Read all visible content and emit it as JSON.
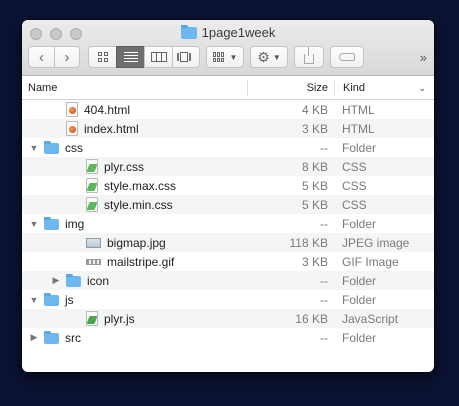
{
  "window": {
    "title": "1page1week"
  },
  "toolbar": {
    "back_glyph": "‹",
    "forward_glyph": "›",
    "overflow_glyph": "»",
    "icons": [
      "icon-view-icon",
      "list-view-icon",
      "column-view-icon",
      "coverflow-view-icon",
      "group-by-icon",
      "action-gear-icon",
      "share-icon",
      "tag-icon"
    ]
  },
  "columns": {
    "name": "Name",
    "size": "Size",
    "kind": "Kind"
  },
  "rows": [
    {
      "indent": 1,
      "disclosure": "",
      "icon": "html-file",
      "name": "404.html",
      "size": "4 KB",
      "kind": "HTML"
    },
    {
      "indent": 1,
      "disclosure": "",
      "icon": "html-file",
      "name": "index.html",
      "size": "3 KB",
      "kind": "HTML"
    },
    {
      "indent": 0,
      "disclosure": "▼",
      "icon": "folder",
      "name": "css",
      "size": "--",
      "kind": "Folder"
    },
    {
      "indent": 2,
      "disclosure": "",
      "icon": "css-file",
      "name": "plyr.css",
      "size": "8 KB",
      "kind": "CSS"
    },
    {
      "indent": 2,
      "disclosure": "",
      "icon": "css-file",
      "name": "style.max.css",
      "size": "5 KB",
      "kind": "CSS"
    },
    {
      "indent": 2,
      "disclosure": "",
      "icon": "css-file",
      "name": "style.min.css",
      "size": "5 KB",
      "kind": "CSS"
    },
    {
      "indent": 0,
      "disclosure": "▼",
      "icon": "folder",
      "name": "img",
      "size": "--",
      "kind": "Folder"
    },
    {
      "indent": 2,
      "disclosure": "",
      "icon": "jpeg-image",
      "name": "bigmap.jpg",
      "size": "118 KB",
      "kind": "JPEG image"
    },
    {
      "indent": 2,
      "disclosure": "",
      "icon": "gif-image",
      "name": "mailstripe.gif",
      "size": "3 KB",
      "kind": "GIF Image"
    },
    {
      "indent": 1,
      "disclosure": "▶",
      "icon": "folder",
      "name": "icon",
      "size": "--",
      "kind": "Folder"
    },
    {
      "indent": 0,
      "disclosure": "▼",
      "icon": "folder",
      "name": "js",
      "size": "--",
      "kind": "Folder"
    },
    {
      "indent": 2,
      "disclosure": "",
      "icon": "js-file",
      "name": "plyr.js",
      "size": "16 KB",
      "kind": "JavaScript"
    },
    {
      "indent": 0,
      "disclosure": "▶",
      "icon": "folder",
      "name": "src",
      "size": "--",
      "kind": "Folder"
    }
  ],
  "colors": {
    "desktop": "#0b1233",
    "folder": "#6eb8ef",
    "stripe": "#f4f5f5",
    "secondary_text": "#7a7a7a"
  }
}
